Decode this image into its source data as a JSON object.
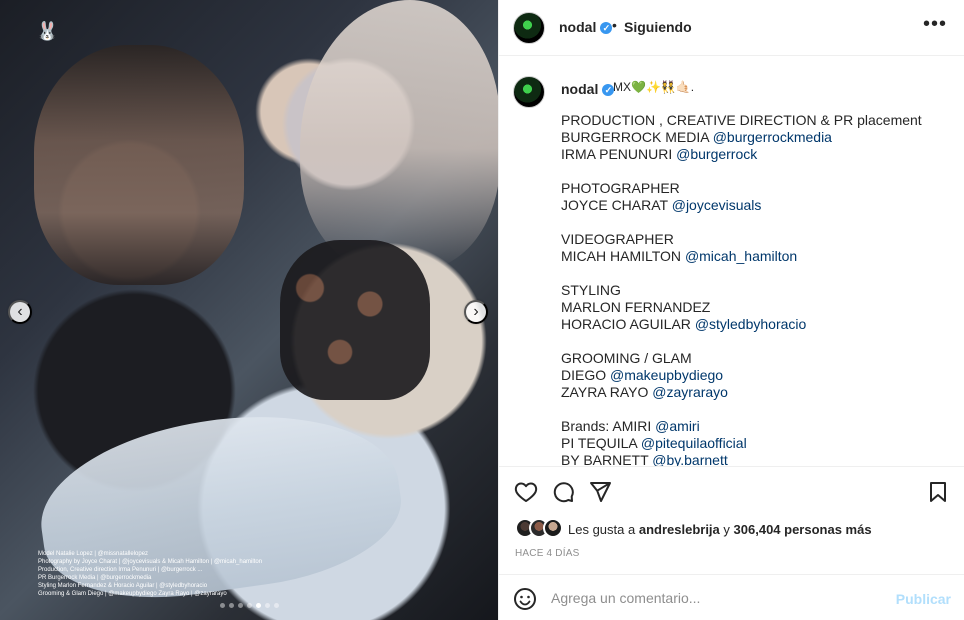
{
  "post": {
    "username": "nodal",
    "follow_status": "Siguiendo",
    "more_icon": "more-options-icon"
  },
  "media": {
    "credits_lines": [
      "Model Natalie Lopez | @missnatallelopez",
      "Photography by Joyce Charat | @joycevisuals & Micah Hamilton | @micah_hamilton",
      "Production, Creative direction Irma Penunuri | @burgerrock ...",
      "PR Burgerrock Media | @burgerrockmedia",
      "Styling Marlon Fernandez & Horacio Aguilar | @styledbyhoracio",
      "Grooming & Glam Diego | @makeupbydiego Zayra Rayo | @zayrarayo"
    ],
    "carousel": {
      "total": 7,
      "active_index": 4
    }
  },
  "caption": {
    "username": "nodal",
    "emoji_suffix": "MX💚✨👯🤙🏻.",
    "lines": [
      [
        {
          "t": "PRODUCTION , CREATIVE DIRECTION & PR placement"
        }
      ],
      [
        {
          "t": "BURGERROCK MEDIA "
        },
        {
          "t": "@burgerrockmedia",
          "link": true
        }
      ],
      [
        {
          "t": "IRMA PENUNURI "
        },
        {
          "t": "@burgerrock",
          "link": true
        }
      ],
      [],
      [
        {
          "t": "PHOTOGRAPHER"
        }
      ],
      [
        {
          "t": "JOYCE CHARAT "
        },
        {
          "t": "@joycevisuals",
          "link": true
        }
      ],
      [],
      [
        {
          "t": "VIDEOGRAPHER"
        }
      ],
      [
        {
          "t": "MICAH HAMILTON "
        },
        {
          "t": "@micah_hamilton",
          "link": true
        }
      ],
      [],
      [
        {
          "t": "STYLING"
        }
      ],
      [
        {
          "t": "MARLON FERNANDEZ"
        }
      ],
      [
        {
          "t": "HORACIO AGUILAR "
        },
        {
          "t": "@styledbyhoracio",
          "link": true
        }
      ],
      [],
      [
        {
          "t": "GROOMING / GLAM"
        }
      ],
      [
        {
          "t": "DIEGO "
        },
        {
          "t": "@makeupbydiego",
          "link": true
        }
      ],
      [
        {
          "t": "ZAYRA RAYO "
        },
        {
          "t": "@zayrarayo",
          "link": true
        }
      ],
      [],
      [
        {
          "t": "Brands: AMIRI "
        },
        {
          "t": "@amiri",
          "link": true
        }
      ],
      [
        {
          "t": "PI TEQUILA "
        },
        {
          "t": "@pitequilaofficial",
          "link": true
        }
      ],
      [
        {
          "t": "BY BARNETT "
        },
        {
          "t": "@by.barnett",
          "link": true
        }
      ]
    ]
  },
  "likes": {
    "prefix": "Les gusta a",
    "user": "andreslebrija",
    "connector": "y",
    "count": "306,404 personas más"
  },
  "time_ago": "HACE 4 DÍAS",
  "comment": {
    "placeholder": "Agrega un comentario...",
    "publish_label": "Publicar"
  },
  "colors": {
    "link": "#00376b",
    "verified": "#3897f0",
    "publish_disabled": "#b2dffc"
  }
}
